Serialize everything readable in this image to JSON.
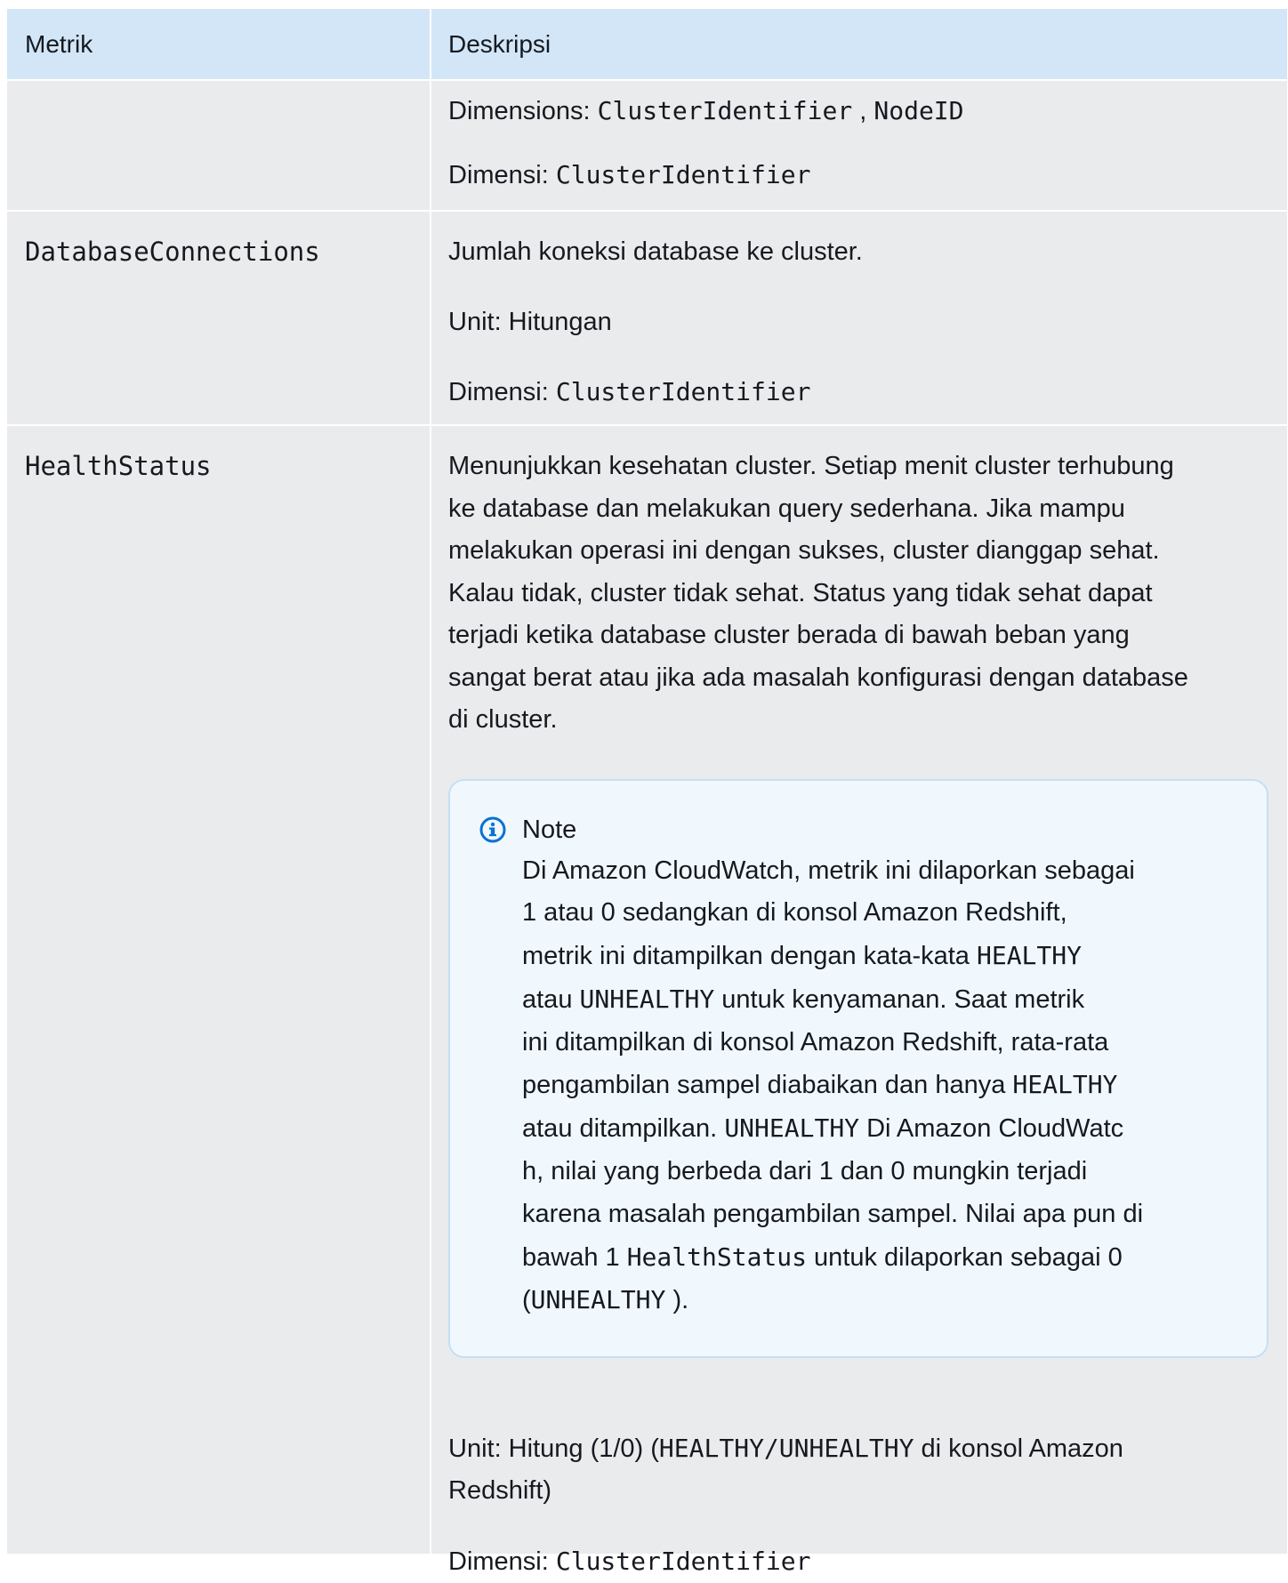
{
  "header": {
    "col_metric": "Metrik",
    "col_description": "Deskripsi"
  },
  "rows": [
    {
      "metric": "",
      "dimensions_line1_label": "Dimensions: ",
      "dimensions_line1_code1": "ClusterIdentifier",
      "dimensions_line1_sep": " , ",
      "dimensions_line1_code2": "NodeID",
      "dimensions_line2_label": "Dimensi: ",
      "dimensions_line2_code": "ClusterIdentifier"
    },
    {
      "metric": "DatabaseConnections",
      "description": "Jumlah koneksi database ke cluster.",
      "unit": "Unit: Hitungan",
      "dimensions_label": "Dimensi: ",
      "dimensions_code": "ClusterIdentifier"
    },
    {
      "metric": "HealthStatus",
      "description_lines": [
        "Menunjukkan kesehatan cluster. Setiap menit cluster terhubung",
        "ke database dan melakukan query sederhana. Jika mampu",
        "melakukan operasi ini dengan sukses, cluster dianggap sehat.",
        "Kalau tidak, cluster tidak sehat. Status yang tidak sehat dapat",
        "terjadi ketika database cluster berada di bawah beban yang",
        "sangat berat atau jika ada masalah konfigurasi dengan database",
        "di cluster."
      ],
      "note": {
        "icon": "info-icon",
        "title": "Note",
        "l1": "Di Amazon CloudWatch, metrik ini dilaporkan sebagai",
        "l2": "1 atau 0 sedangkan di konsol Amazon Redshift,",
        "l3_text": "metrik ini ditampilkan dengan kata-kata ",
        "l3_code": "HEALTHY",
        "l4_text1": "atau ",
        "l4_code": "UNHEALTHY",
        "l4_text2": "  untuk kenyamanan. Saat metrik",
        "l5": "ini ditampilkan di konsol Amazon Redshift, rata-rata",
        "l6_text": "pengambilan sampel diabaikan dan hanya ",
        "l6_code": "HEALTHY",
        "l7_text1": "atau ditampilkan. ",
        "l7_code": "UNHEALTHY",
        "l7_text2": "  Di Amazon CloudWatc",
        "l8": "h, nilai yang berbeda dari 1 dan 0 mungkin terjadi",
        "l9": "karena masalah pengambilan sampel. Nilai apa pun di",
        "l10_text1": "bawah 1 ",
        "l10_code": "HealthStatus",
        "l10_text2": "  untuk dilaporkan sebagai 0",
        "l11_text1": "(",
        "l11_code": "UNHEALTHY",
        "l11_text2": " )."
      },
      "unit_text1": "Unit: Hitung (1/0) (",
      "unit_code": "HEALTHY/UNHEALTHY",
      "unit_text2": "  di konsol Amazon",
      "unit_line2": "Redshift)",
      "dimensions_label": "Dimensi: ",
      "dimensions_code": "ClusterIdentifier"
    }
  ],
  "colors": {
    "header_bg": "#d2e6f7",
    "row_bg": "#eaebed",
    "note_bg": "#f1f8fd",
    "note_border": "#c4dff4",
    "info_icon": "#0972d3"
  }
}
